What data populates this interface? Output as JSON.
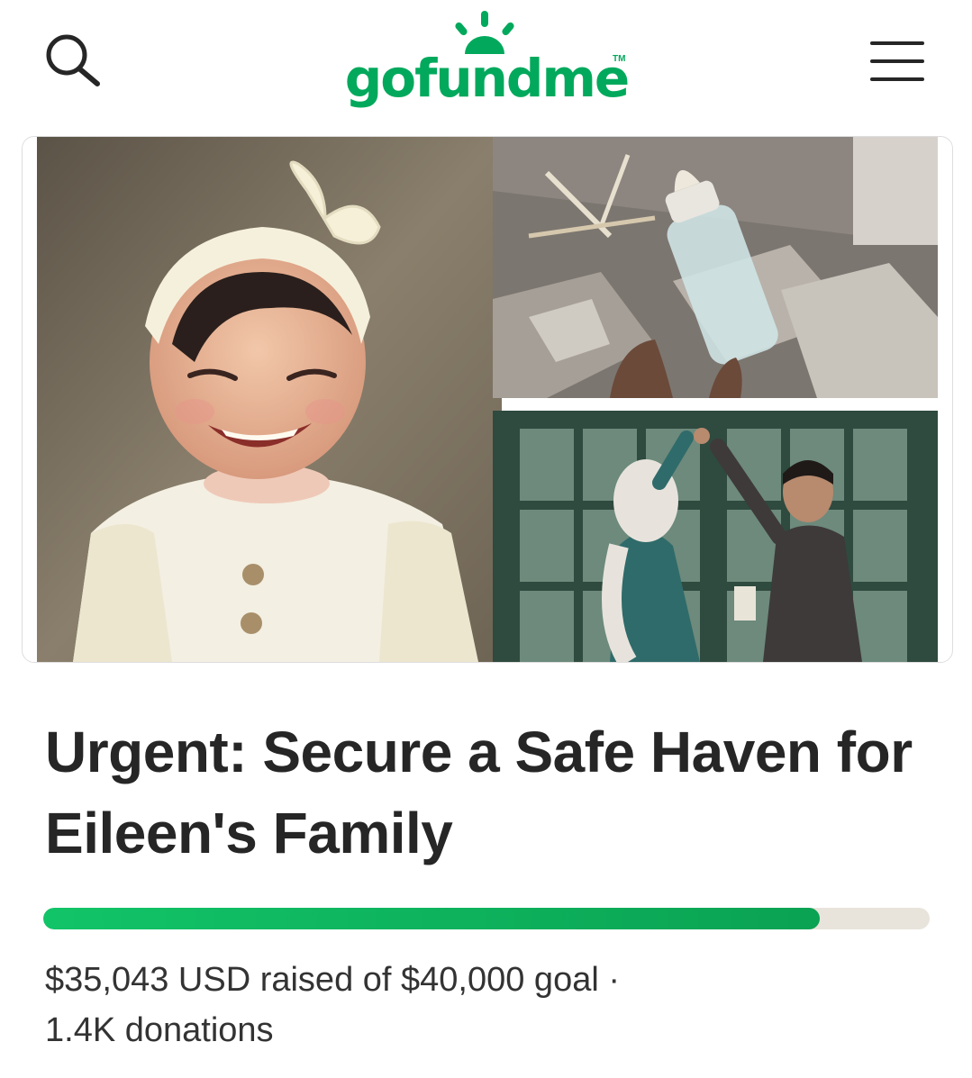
{
  "header": {
    "logo_text": "gofundme",
    "logo_tm": "TM",
    "search_icon": "search-icon",
    "menu_icon": "hamburger-menu-icon"
  },
  "colors": {
    "brand_green": "#02a95c",
    "progress_fill": "#0fb25e",
    "progress_track": "#e8e4dc",
    "text": "#262626"
  },
  "campaign": {
    "title": "Urgent: Secure a Safe Haven for Eileen's Family",
    "raised_text": "$35,043 USD raised of $40,000 goal ·",
    "donations_text": "1.4K donations",
    "raised_amount": 35043,
    "goal_amount": 40000,
    "progress_fraction": 0.876
  },
  "gallery": {
    "images": [
      {
        "name": "photo-smiling-child"
      },
      {
        "name": "photo-baby-bottle-in-rubble"
      },
      {
        "name": "photo-couple-at-door"
      }
    ]
  }
}
